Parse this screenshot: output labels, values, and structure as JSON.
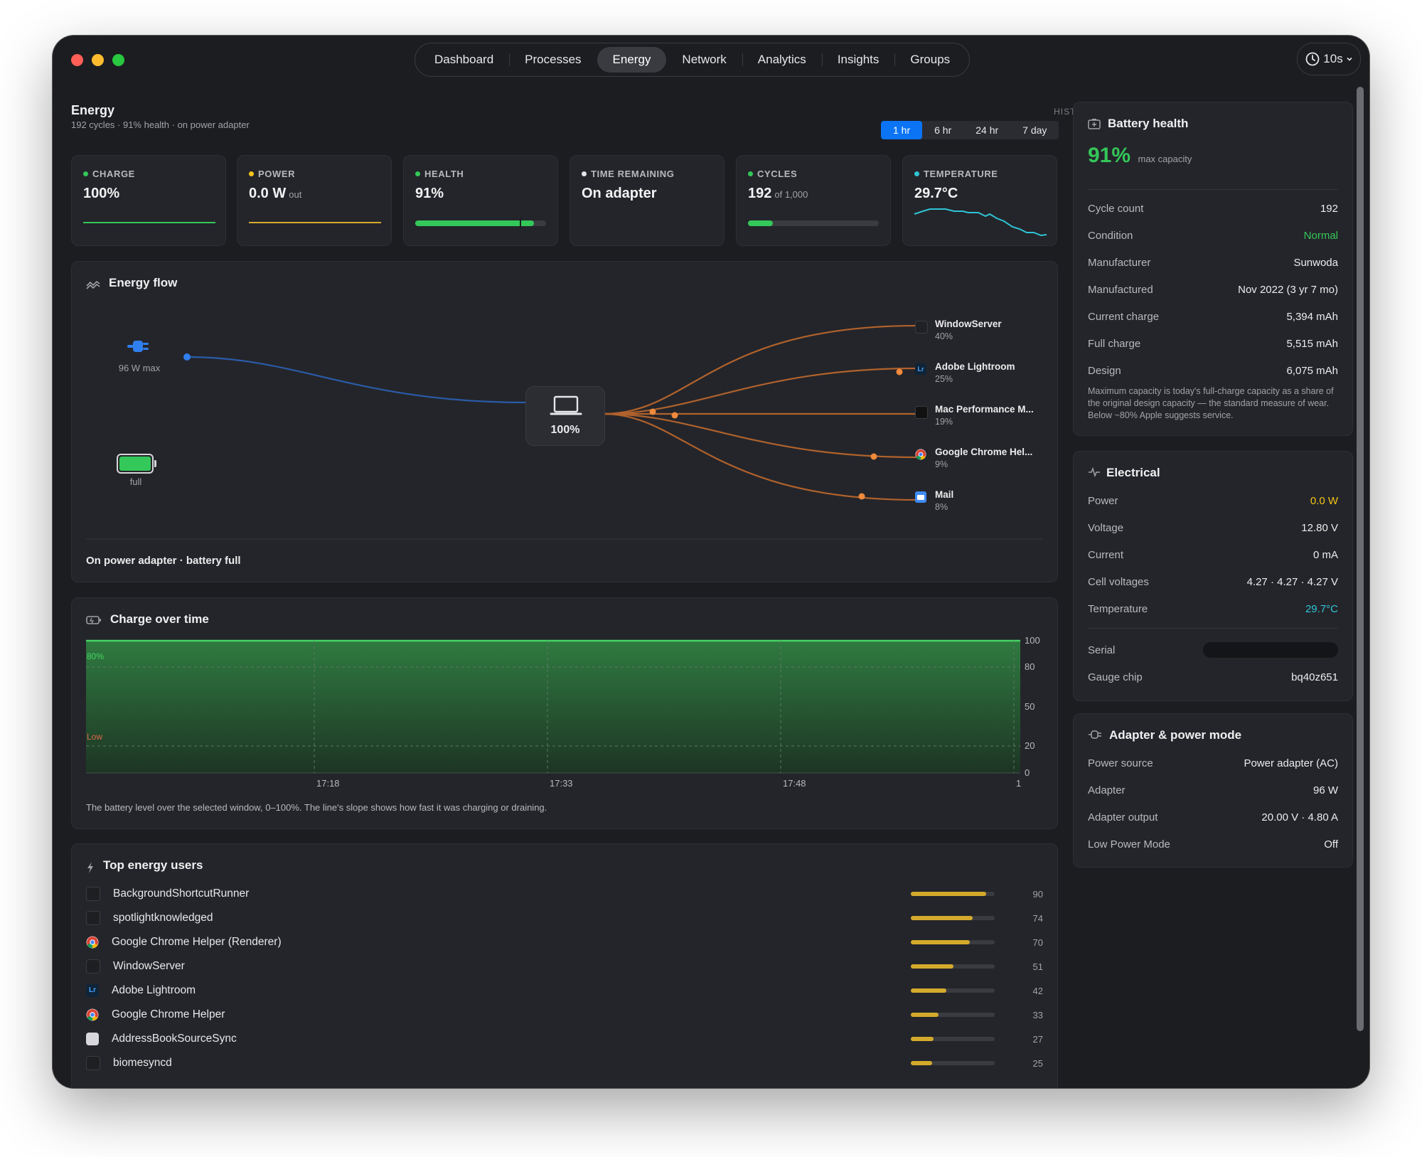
{
  "nav": {
    "tabs": [
      {
        "label": "Dashboard"
      },
      {
        "label": "Processes"
      },
      {
        "label": "Energy"
      },
      {
        "label": "Network"
      },
      {
        "label": "Analytics"
      },
      {
        "label": "Insights"
      },
      {
        "label": "Groups"
      }
    ],
    "active_tab": "Energy",
    "refresh_interval": "10s"
  },
  "header": {
    "title": "Energy",
    "subtitle": "192 cycles · 91% health · on power adapter",
    "history_label": "HISTORY",
    "history_options": [
      "1 hr",
      "6 hr",
      "24 hr",
      "7 day"
    ],
    "history_selected": "1 hr"
  },
  "stats": [
    {
      "label": "CHARGE",
      "value": "100%",
      "unit": "",
      "color": "#34c759",
      "level": 1.0
    },
    {
      "label": "POWER",
      "value": "0.0 W",
      "unit": "out",
      "color": "#f5c518"
    },
    {
      "label": "HEALTH",
      "value": "91%",
      "unit": "",
      "color": "#34c759",
      "level": 0.91
    },
    {
      "label": "TIME REMAINING",
      "value": "On adapter",
      "unit": "",
      "color": "#e6e6e8"
    },
    {
      "label": "CYCLES",
      "value": "192",
      "unit": "of 1,000",
      "color": "#34c759",
      "level": 0.192
    },
    {
      "label": "TEMPERATURE",
      "value": "29.7°C",
      "unit": "",
      "color": "#2ec4d6"
    }
  ],
  "energy_flow": {
    "title": "Energy flow",
    "adapter_label": "96 W max",
    "battery_label": "full",
    "device_label": "100%",
    "footer": "On power adapter · battery full",
    "consumers": [
      {
        "name": "WindowServer",
        "pct": "40%",
        "icon": "app-icon"
      },
      {
        "name": "Adobe Lightroom",
        "pct": "25%",
        "icon": "lightroom-icon"
      },
      {
        "name": "Mac Performance M...",
        "pct": "19%",
        "icon": "app-icon"
      },
      {
        "name": "Google Chrome Hel...",
        "pct": "9%",
        "icon": "chrome-icon"
      },
      {
        "name": "Mail",
        "pct": "8%",
        "icon": "mail-icon"
      }
    ]
  },
  "charge_chart": {
    "title": "Charge over time",
    "caption": "The battery level over the selected window, 0–100%. The line's slope shows how fast it was charging or draining.",
    "marker_80": "80%",
    "marker_low": "Low",
    "x_ticks": [
      "17:18",
      "17:33",
      "17:48",
      "1"
    ],
    "y_ticks": [
      "100",
      "80",
      "50",
      "20",
      "0"
    ]
  },
  "top_users": {
    "title": "Top energy users",
    "items": [
      {
        "name": "BackgroundShortcutRunner",
        "value": "90",
        "level": 90,
        "icon": "app-icon"
      },
      {
        "name": "spotlightknowledged",
        "value": "74",
        "level": 74,
        "icon": "app-icon"
      },
      {
        "name": "Google Chrome Helper (Renderer)",
        "value": "70",
        "level": 70,
        "icon": "chrome-icon"
      },
      {
        "name": "WindowServer",
        "value": "51",
        "level": 51,
        "icon": "app-icon"
      },
      {
        "name": "Adobe Lightroom",
        "value": "42",
        "level": 42,
        "icon": "lightroom-icon"
      },
      {
        "name": "Google Chrome Helper",
        "value": "33",
        "level": 33,
        "icon": "chrome-icon"
      },
      {
        "name": "AddressBookSourceSync",
        "value": "27",
        "level": 27,
        "icon": "generic-app-icon"
      },
      {
        "name": "biomesyncd",
        "value": "25",
        "level": 25,
        "icon": "app-icon"
      }
    ]
  },
  "battery_health": {
    "title": "Battery health",
    "percent": "91%",
    "percent_label": "max capacity",
    "rows": [
      {
        "key": "Cycle count",
        "value": "192"
      },
      {
        "key": "Condition",
        "value": "Normal"
      },
      {
        "key": "Manufacturer",
        "value": "Sunwoda"
      },
      {
        "key": "Manufactured",
        "value": "Nov 2022 (3 yr 7 mo)"
      },
      {
        "key": "Current charge",
        "value": "5,394 mAh"
      },
      {
        "key": "Full charge",
        "value": "5,515 mAh"
      },
      {
        "key": "Design",
        "value": "6,075 mAh"
      }
    ],
    "note": "Maximum capacity is today's full-charge capacity as a share of the original design capacity — the standard measure of wear. Below ~80% Apple suggests service."
  },
  "electrical": {
    "title": "Electrical",
    "rows": [
      {
        "key": "Power",
        "value": "0.0 W"
      },
      {
        "key": "Voltage",
        "value": "12.80 V"
      },
      {
        "key": "Current",
        "value": "0 mA"
      },
      {
        "key": "Cell voltages",
        "value": "4.27 · 4.27 · 4.27 V"
      },
      {
        "key": "Temperature",
        "value": "29.7°C"
      }
    ],
    "serial_label": "Serial",
    "gauge_label": "Gauge chip",
    "gauge_value": "bq40z651"
  },
  "adapter": {
    "title": "Adapter & power mode",
    "rows": [
      {
        "key": "Power source",
        "value": "Power adapter (AC)"
      },
      {
        "key": "Adapter",
        "value": "96 W"
      },
      {
        "key": "Adapter output",
        "value": "20.00 V · 4.80 A"
      },
      {
        "key": "Low Power Mode",
        "value": "Off"
      }
    ]
  },
  "colors": {
    "accent": "#0a74f5",
    "green": "#34c759",
    "yellow": "#f5c518",
    "cyan": "#2ec4d6",
    "flow_orange": "#c46a2e"
  }
}
